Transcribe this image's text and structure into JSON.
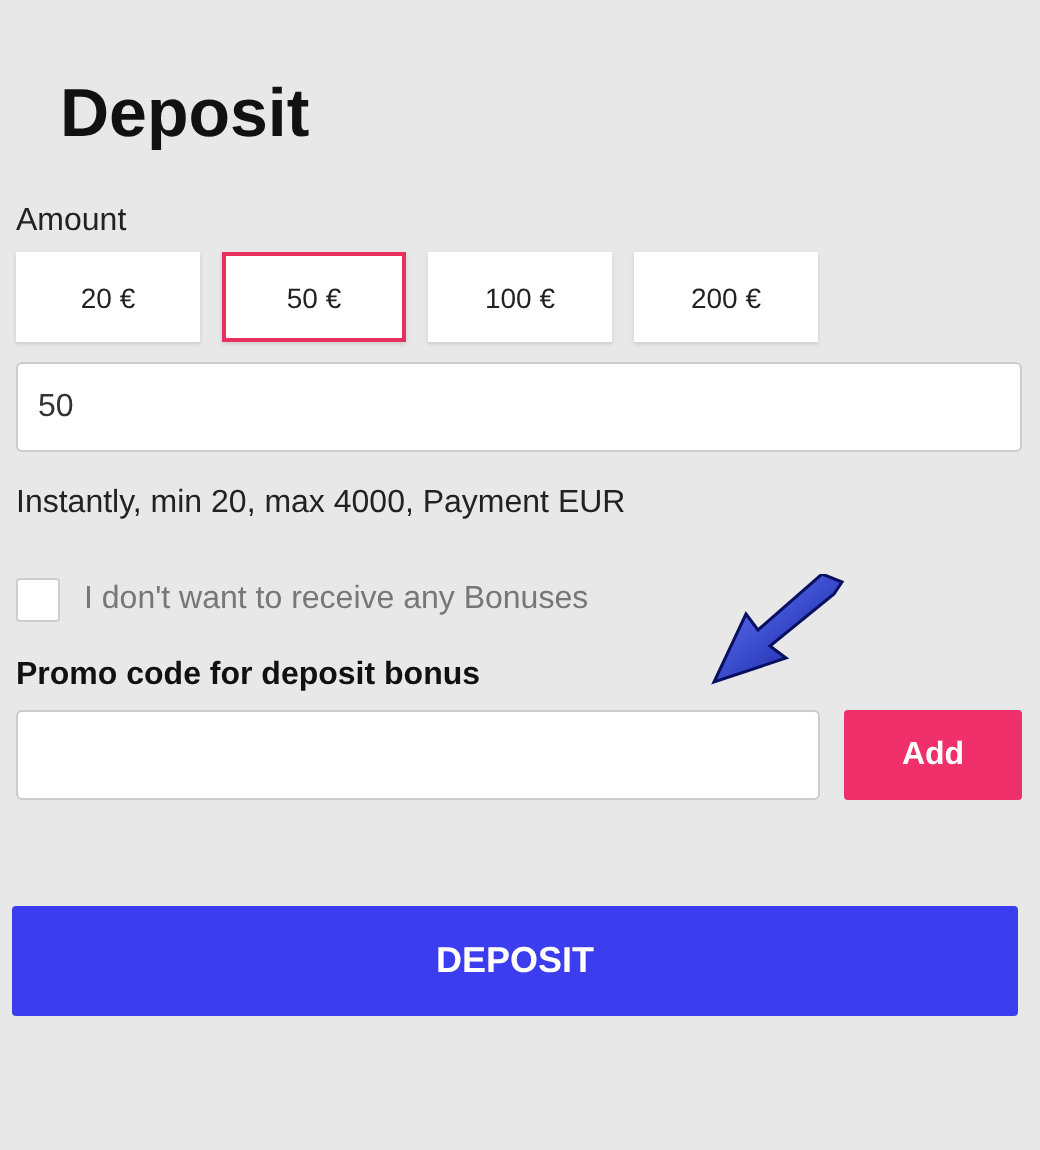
{
  "title": "Deposit",
  "amount": {
    "label": "Amount",
    "presets": [
      {
        "label": "20 €",
        "selected": false
      },
      {
        "label": "50 €",
        "selected": true
      },
      {
        "label": "100 €",
        "selected": false
      },
      {
        "label": "200 €",
        "selected": false
      }
    ],
    "value": "50"
  },
  "info": "Instantly, min 20, max 4000, Payment EUR",
  "no_bonus": {
    "label": "I don't want to receive any Bonuses",
    "checked": false
  },
  "promo": {
    "label": "Promo code for deposit bonus",
    "button": "Add"
  },
  "submit": "DEPOSIT"
}
